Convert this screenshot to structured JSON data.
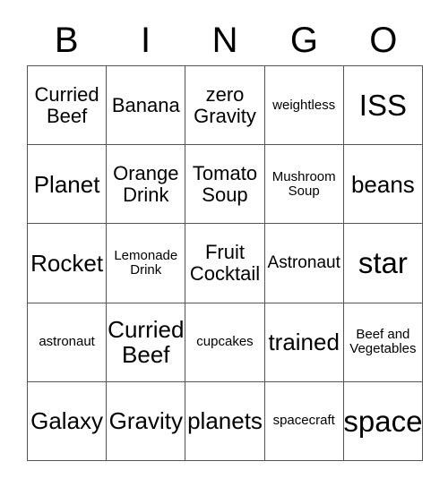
{
  "card": {
    "title": "BINGO",
    "header_letters": [
      "B",
      "I",
      "N",
      "G",
      "O"
    ],
    "border_color": "#555555",
    "text_color": "#000000",
    "background_color": "#ffffff",
    "rows": 5,
    "columns": 5,
    "cells": [
      [
        {
          "text": "Curried\nBeef",
          "size": "md"
        },
        {
          "text": "Banana",
          "size": "md"
        },
        {
          "text": "zero\nGravity",
          "size": "md"
        },
        {
          "text": "weightless",
          "size": "xs"
        },
        {
          "text": "ISS",
          "size": "xl"
        }
      ],
      [
        {
          "text": "Planet",
          "size": "lg"
        },
        {
          "text": "Orange\nDrink",
          "size": "md"
        },
        {
          "text": "Tomato\nSoup",
          "size": "md"
        },
        {
          "text": "Mushroom\nSoup",
          "size": "xs"
        },
        {
          "text": "beans",
          "size": "lg"
        }
      ],
      [
        {
          "text": "Rocket",
          "size": "lg"
        },
        {
          "text": "Lemonade\nDrink",
          "size": "xs"
        },
        {
          "text": "Fruit\nCocktail",
          "size": "md"
        },
        {
          "text": "Astronaut",
          "size": "sm"
        },
        {
          "text": "star",
          "size": "xl"
        }
      ],
      [
        {
          "text": "astronaut",
          "size": "xs"
        },
        {
          "text": "Curried\nBeef",
          "size": "lg"
        },
        {
          "text": "cupcakes",
          "size": "xs"
        },
        {
          "text": "trained",
          "size": "lg"
        },
        {
          "text": "Beef and\nVegetables",
          "size": "xs"
        }
      ],
      [
        {
          "text": "Galaxy",
          "size": "lg"
        },
        {
          "text": "Gravity",
          "size": "lg"
        },
        {
          "text": "planets",
          "size": "lg"
        },
        {
          "text": "spacecraft",
          "size": "xs"
        },
        {
          "text": "space",
          "size": "xl"
        }
      ]
    ]
  }
}
